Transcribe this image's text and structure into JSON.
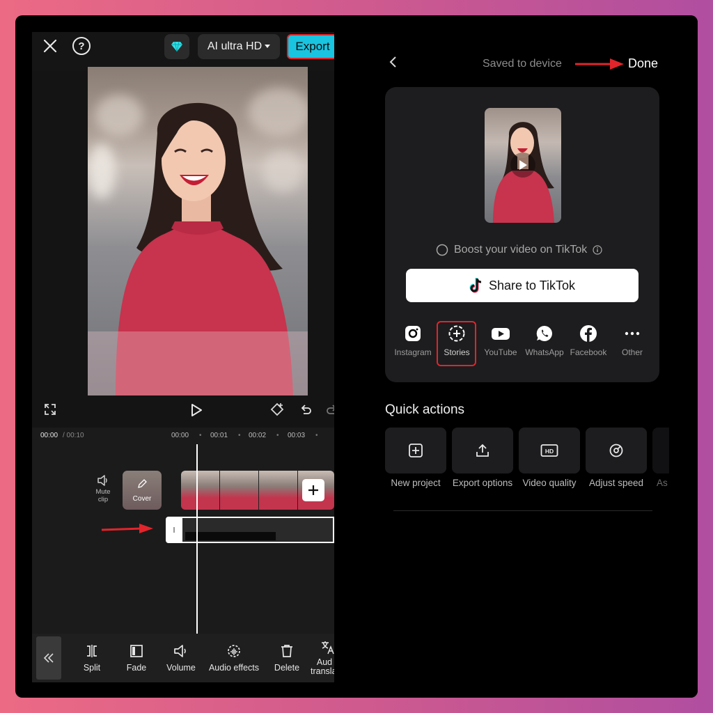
{
  "editor": {
    "quality_label": "AI ultra HD",
    "export_label": "Export",
    "time_current": "00:00",
    "time_total": "/ 00:10",
    "ruler_ticks": [
      "00:00",
      "00:01",
      "00:02",
      "00:03"
    ],
    "mute_label": "Mute clip",
    "cover_label": "Cover",
    "toolbar": {
      "split": "Split",
      "fade": "Fade",
      "volume": "Volume",
      "audio_effects": "Audio effects",
      "delete": "Delete",
      "audio_translate_partial": "Aud translat"
    }
  },
  "share": {
    "saved_text": "Saved to device",
    "done_label": "Done",
    "boost_text": "Boost your video on TikTok",
    "tiktok_button": "Share to TikTok",
    "targets": [
      "Instagram",
      "Stories",
      "YouTube",
      "WhatsApp",
      "Facebook",
      "Other"
    ]
  },
  "quick_actions": {
    "title": "Quick actions",
    "items": [
      "New project",
      "Export options",
      "Video quality",
      "Adjust speed",
      "As"
    ]
  },
  "colors": {
    "accent_export": "#19c4e0",
    "highlight_red": "#e3242b",
    "background_gradient_left": "#ec6a84",
    "background_gradient_right": "#b04ea0"
  }
}
